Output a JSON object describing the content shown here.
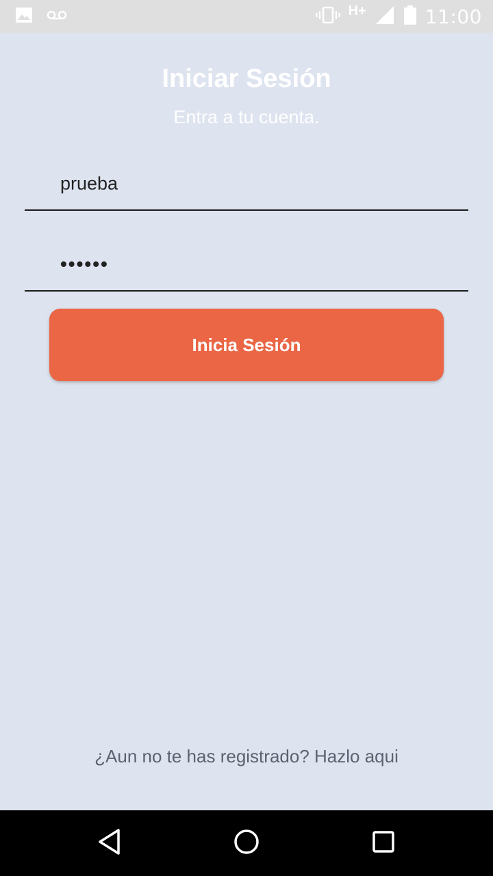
{
  "status_bar": {
    "icons_left": [
      "image-icon",
      "voicemail-icon"
    ],
    "network": "H+",
    "icons_right": [
      "vibrate-icon",
      "signal-icon",
      "battery-icon"
    ],
    "time": "11:00"
  },
  "login": {
    "title": "Iniciar Sesión",
    "subtitle": "Entra a tu cuenta.",
    "username_value": "prueba",
    "password_masked": "••••••",
    "submit_label": "Inicia Sesión",
    "register_link": "¿Aun no te has registrado? Hazlo aqui"
  },
  "colors": {
    "background": "#dde3ef",
    "accent": "#ea6645",
    "status_bar": "#dfdfdf",
    "nav_bar": "#000000"
  },
  "nav_bar": {
    "buttons": [
      "back-icon",
      "home-icon",
      "recents-icon"
    ]
  }
}
